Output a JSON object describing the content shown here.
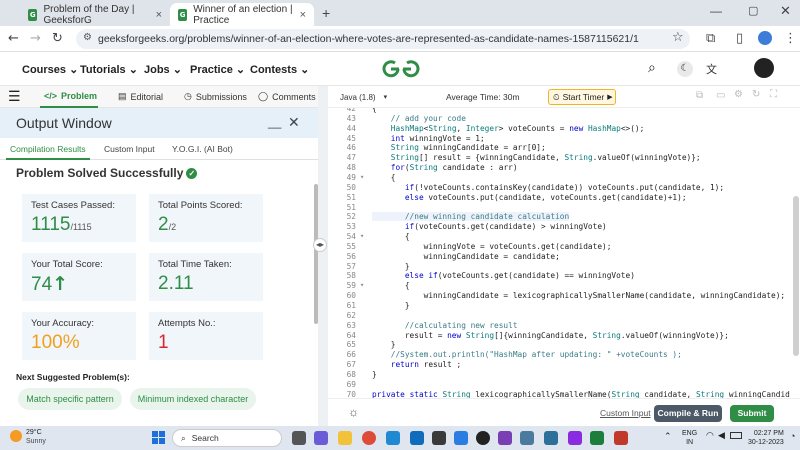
{
  "browser": {
    "tabs": [
      {
        "title": "Problem of the Day | GeeksforG",
        "active": false
      },
      {
        "title": "Winner of an election | Practice",
        "active": true
      }
    ],
    "url": "geeksforgeeks.org/problems/winner-of-an-election-where-votes-are-represented-as-candidate-names-1587115621/1"
  },
  "site": {
    "menu": [
      "Courses",
      "Tutorials",
      "Jobs",
      "Practice",
      "Contests"
    ],
    "logo": "GfG"
  },
  "left": {
    "tabs": [
      "Problem",
      "Editorial",
      "Submissions",
      "Comments"
    ],
    "output_title": "Output Window",
    "subtabs": [
      "Compilation Results",
      "Custom Input",
      "Y.O.G.I. (AI Bot)"
    ],
    "status": "Problem Solved Successfully",
    "cards": {
      "test_label": "Test Cases Passed:",
      "test_value": "1115",
      "test_total": "/1115",
      "points_label": "Total Points Scored:",
      "points_value": "2",
      "points_total": "/2",
      "score_label": "Your Total Score:",
      "score_value": "74",
      "time_label": "Total Time Taken:",
      "time_value": "2.11",
      "acc_label": "Your Accuracy:",
      "acc_value": "100%",
      "attempts_label": "Attempts No.:",
      "attempts_value": "1"
    },
    "next_label": "Next Suggested Problem(s):",
    "next": [
      "Match specific pattern",
      "Minimum indexed character"
    ]
  },
  "editor": {
    "language": "Java (1.8)",
    "avg_time": "Average Time: 30m",
    "timer": "Start Timer",
    "custom_input": "Custom Input",
    "compile": "Compile & Run",
    "submit": "Submit",
    "lines": [
      {
        "n": "42",
        "f": "",
        "t": "{"
      },
      {
        "n": "43",
        "f": "",
        "t": "    // add your code"
      },
      {
        "n": "44",
        "f": "",
        "t": "    HashMap<String, Integer> voteCounts = new HashMap<>();"
      },
      {
        "n": "45",
        "f": "",
        "t": "    int winningVote = 1;"
      },
      {
        "n": "46",
        "f": "",
        "t": "    String winningCandidate = arr[0];"
      },
      {
        "n": "47",
        "f": "",
        "t": "    String[] result = {winningCandidate, String.valueOf(winningVote)};"
      },
      {
        "n": "48",
        "f": "",
        "t": "    for(String candidate : arr)"
      },
      {
        "n": "49",
        "f": "▾",
        "t": "    {"
      },
      {
        "n": "50",
        "f": "",
        "t": "       if(!voteCounts.containsKey(candidate)) voteCounts.put(candidate, 1);"
      },
      {
        "n": "51",
        "f": "",
        "t": "       else voteCounts.put(candidate, voteCounts.get(candidate)+1);"
      },
      {
        "n": "51",
        "f": "",
        "t": ""
      },
      {
        "n": "52",
        "f": "",
        "t": "       //new winning candidate calculation"
      },
      {
        "n": "53",
        "f": "",
        "t": "       if(voteCounts.get(candidate) > winningVote)"
      },
      {
        "n": "54",
        "f": "▾",
        "t": "       {"
      },
      {
        "n": "55",
        "f": "",
        "t": "           winningVote = voteCounts.get(candidate);"
      },
      {
        "n": "56",
        "f": "",
        "t": "           winningCandidate = candidate;"
      },
      {
        "n": "57",
        "f": "",
        "t": "       }"
      },
      {
        "n": "58",
        "f": "",
        "t": "       else if(voteCounts.get(candidate) == winningVote)"
      },
      {
        "n": "59",
        "f": "▾",
        "t": "       {"
      },
      {
        "n": "60",
        "f": "",
        "t": "           winningCandidate = lexicographicallySmallerName(candidate, winningCandidate);"
      },
      {
        "n": "61",
        "f": "",
        "t": "       }"
      },
      {
        "n": "62",
        "f": "",
        "t": ""
      },
      {
        "n": "63",
        "f": "",
        "t": "       //calculating new result"
      },
      {
        "n": "64",
        "f": "",
        "t": "       result = new String[]{winningCandidate, String.valueOf(winningVote)};"
      },
      {
        "n": "65",
        "f": "",
        "t": "    }"
      },
      {
        "n": "66",
        "f": "",
        "t": "    //System.out.println(\"HashMap after updating: \" +voteCounts );"
      },
      {
        "n": "67",
        "f": "",
        "t": "    return result ;"
      },
      {
        "n": "68",
        "f": "",
        "t": "}"
      },
      {
        "n": "69",
        "f": "",
        "t": ""
      },
      {
        "n": "70",
        "f": "",
        "t": "private static String lexicographicallySmallerName(String candidate, String winningCandid"
      }
    ]
  },
  "taskbar": {
    "weather_temp": "29°C",
    "weather_desc": "Sunny",
    "search": "Search",
    "lang1": "ENG",
    "lang2": "IN",
    "time": "02:27 PM",
    "date": "30-12-2023"
  }
}
